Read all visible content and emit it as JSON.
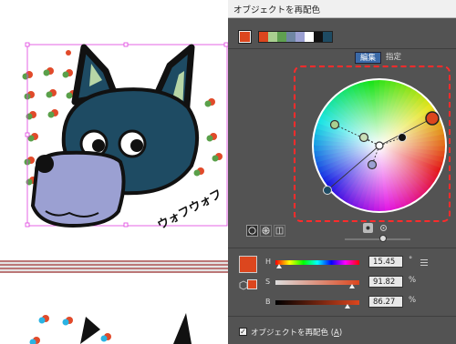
{
  "dialog": {
    "title": "オブジェクトを再配色",
    "current_color": "#dc461e",
    "swatches": [
      {
        "name": "swatch-orange",
        "color": "#dc461e"
      },
      {
        "name": "swatch-light-green",
        "color": "#a9cf90"
      },
      {
        "name": "swatch-green",
        "color": "#5fa050"
      },
      {
        "name": "swatch-blue-gray",
        "color": "#6f86a3"
      },
      {
        "name": "swatch-periwinkle",
        "color": "#9ba0d2"
      },
      {
        "name": "swatch-white",
        "color": "#ffffff"
      },
      {
        "name": "swatch-black",
        "color": "#111111"
      },
      {
        "name": "swatch-dark-teal",
        "color": "#1e4b63"
      }
    ],
    "tabs": {
      "edit": "編集",
      "assign": "指定"
    },
    "hsb": {
      "h_label": "H",
      "h_value": "15.45",
      "h_unit": "°",
      "s_label": "S",
      "s_value": "91.82",
      "s_unit": "%",
      "b_label": "B",
      "b_value": "86.27",
      "b_unit": "%"
    },
    "hsb_levels": {
      "h": 0.043,
      "s": 0.918,
      "b": 0.863
    },
    "recolor_checkbox": {
      "label_prefix": "オブジェクトを再配色 (",
      "label_key": "A",
      "label_suffix": ")",
      "checked": true
    }
  },
  "artboard": {
    "text": "ウォフウォフ"
  },
  "colors": {
    "dialog_bg": "#535353",
    "highlight": "#ff2b2b",
    "selection": "#e040e0",
    "dog_face": "#1e4b63",
    "dog_muzzle": "#9ba0d2",
    "ear_inner": "#b7d6a6"
  }
}
